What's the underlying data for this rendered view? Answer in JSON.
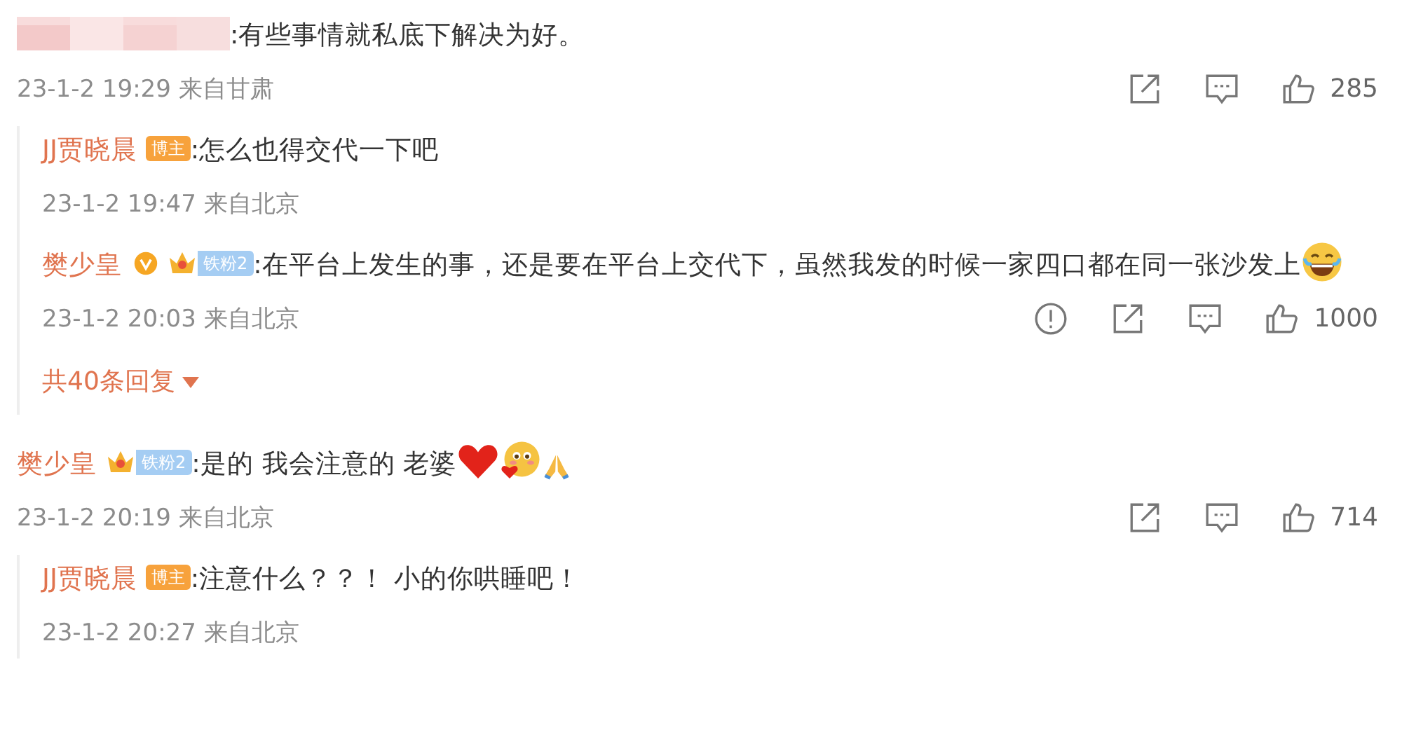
{
  "comments": [
    {
      "user": {
        "redacted": true
      },
      "text": ":有些事情就私底下解决为好。",
      "time": "23-1-2 19:29 来自甘肃",
      "actions": [
        {
          "kind": "share"
        },
        {
          "kind": "comment"
        },
        {
          "kind": "like"
        }
      ],
      "likes": "285",
      "replies": [
        {
          "user": {
            "name": "JJ贾晓晨",
            "verified": false,
            "badges": [
              {
                "kind": "blogger",
                "label": "博主"
              }
            ]
          },
          "text": ":怎么也得交代一下吧",
          "time": "23-1-2 19:47 来自北京"
        },
        {
          "user": {
            "name": "樊少皇",
            "verified": true,
            "badges": [
              {
                "kind": "fan",
                "label": "铁粉2"
              }
            ]
          },
          "text": ":在平台上发生的事，还是要在平台上交代下，虽然我发的时候一家四口都在同一张沙发上",
          "emojis": [
            {
              "kind": "laugh"
            }
          ],
          "time": "23-1-2 20:03 来自北京",
          "actions": [
            {
              "kind": "report"
            },
            {
              "kind": "share"
            },
            {
              "kind": "comment"
            },
            {
              "kind": "like"
            }
          ],
          "likes": "1000"
        }
      ],
      "more_replies": "共40条回复"
    },
    {
      "user": {
        "name": "樊少皇",
        "verified": false,
        "badges": [
          {
            "kind": "fan",
            "label": "铁粉2"
          }
        ]
      },
      "text": ":是的 我会注意的 老婆",
      "emojis": [
        {
          "kind": "heart"
        },
        {
          "kind": "blush"
        },
        {
          "kind": "pray"
        }
      ],
      "time": "23-1-2 20:19 来自北京",
      "actions": [
        {
          "kind": "share"
        },
        {
          "kind": "comment"
        },
        {
          "kind": "like"
        }
      ],
      "likes": "714",
      "replies": [
        {
          "user": {
            "name": "JJ贾晓晨",
            "verified": false,
            "badges": [
              {
                "kind": "blogger",
                "label": "博主"
              }
            ]
          },
          "text": ":注意什么？？！ 小的你哄睡吧！",
          "time": "23-1-2 20:27 来自北京"
        }
      ]
    }
  ]
}
